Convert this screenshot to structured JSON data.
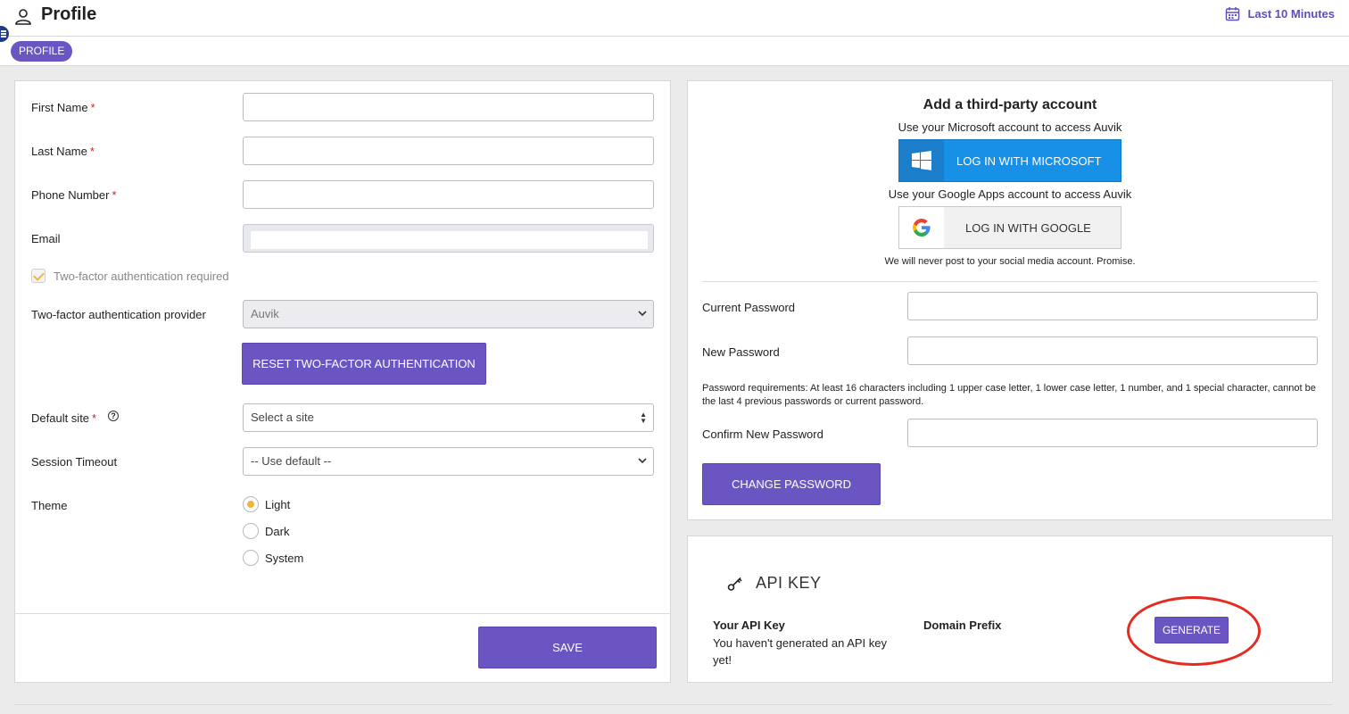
{
  "header": {
    "title": "Profile",
    "time_range": "Last 10 Minutes"
  },
  "tabs": [
    {
      "label": "PROFILE"
    }
  ],
  "profile_form": {
    "first_name": {
      "label": "First Name",
      "required": "*",
      "value": ""
    },
    "last_name": {
      "label": "Last Name",
      "required": "*",
      "value": ""
    },
    "phone": {
      "label": "Phone Number",
      "required": "*",
      "value": ""
    },
    "email": {
      "label": "Email",
      "value": ""
    },
    "two_factor_required": {
      "label": "Two-factor authentication required",
      "checked": true
    },
    "two_factor_provider": {
      "label": "Two-factor authentication provider",
      "value": "Auvik"
    },
    "reset_2fa_label": "RESET TWO-FACTOR AUTHENTICATION",
    "default_site": {
      "label": "Default site",
      "required": "*",
      "placeholder": "Select a site",
      "help": "?"
    },
    "session_timeout": {
      "label": "Session Timeout",
      "value": "-- Use default --"
    },
    "theme": {
      "label": "Theme",
      "options": [
        "Light",
        "Dark",
        "System"
      ],
      "selected": "Light"
    },
    "save_label": "SAVE"
  },
  "third_party": {
    "title": "Add a third-party account",
    "microsoft_text": "Use your Microsoft account to access Auvik",
    "microsoft_button": "LOG IN WITH MICROSOFT",
    "google_text": "Use your Google Apps account to access Auvik",
    "google_button": "LOG IN WITH GOOGLE",
    "note": "We will never post to your social media account. Promise."
  },
  "password": {
    "current_label": "Current Password",
    "new_label": "New Password",
    "requirements": "Password requirements: At least 16 characters including 1 upper case letter, 1 lower case letter, 1 number, and 1 special character, cannot be the last 4 previous passwords or current password.",
    "confirm_label": "Confirm New Password",
    "change_label": "CHANGE PASSWORD"
  },
  "api_key": {
    "title": "API KEY",
    "your_key_label": "Your API Key",
    "your_key_value": "You haven't generated an API key yet!",
    "domain_prefix_label": "Domain Prefix",
    "generate_label": "GENERATE"
  },
  "colors": {
    "accent": "#6a55c2",
    "microsoft": "#1790e8",
    "radio_selected": "#f2b33d",
    "required": "#c5262b",
    "annotation": "#e52b20"
  }
}
